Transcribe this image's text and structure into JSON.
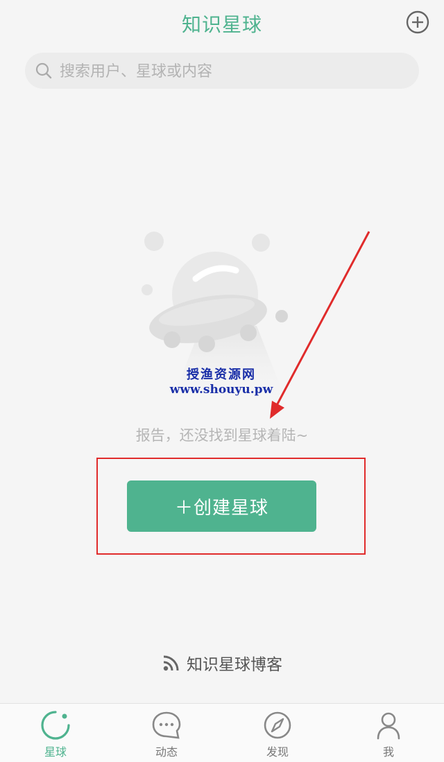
{
  "header": {
    "title": "知识星球",
    "add_icon": "plus-circle-icon"
  },
  "search": {
    "placeholder": "搜索用户、星球或内容",
    "icon": "search-icon"
  },
  "empty_state": {
    "illustration": "ufo-illustration",
    "message": "报告，还没找到星球着陆~"
  },
  "watermark": {
    "line1": "授渔资源网",
    "line2": "www.shouyu.pw"
  },
  "create_button": {
    "label": "＋创建星球"
  },
  "blog_link": {
    "icon": "rss-icon",
    "label": "知识星球博客"
  },
  "tabbar": {
    "tabs": [
      {
        "label": "星球",
        "icon": "planet-icon",
        "active": true
      },
      {
        "label": "动态",
        "icon": "chat-bubble-icon",
        "active": false
      },
      {
        "label": "发现",
        "icon": "compass-icon",
        "active": false
      },
      {
        "label": "我",
        "icon": "user-icon",
        "active": false
      }
    ]
  },
  "colors": {
    "accent": "#4fb38f",
    "annotation_red": "#e02b2b",
    "watermark_blue": "#1a2fa8"
  }
}
